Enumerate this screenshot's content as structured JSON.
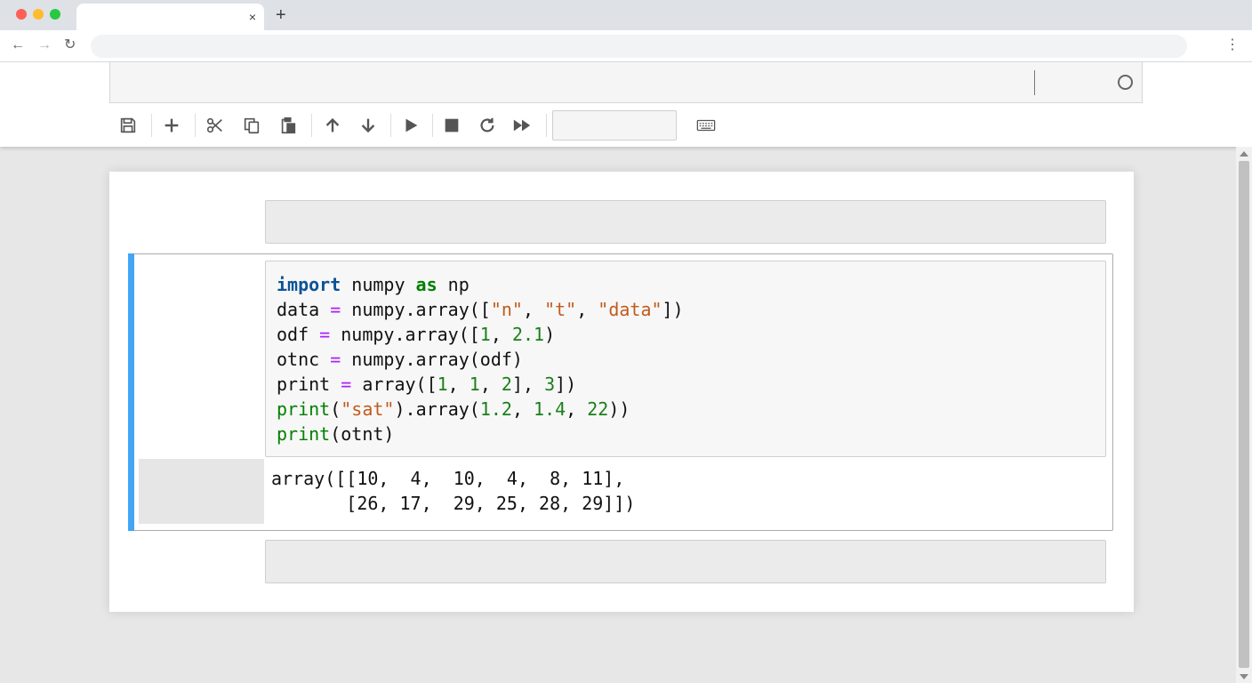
{
  "browser": {
    "tab_close": "×",
    "new_tab": "+",
    "back": "←",
    "forward": "→",
    "reload": "↻",
    "menu": "⋮",
    "traffic_colors": {
      "close": "#fe5f57",
      "minimize": "#febc2e",
      "maximize": "#28c840"
    }
  },
  "toolbar": {
    "icons": [
      "save-icon",
      "plus-icon",
      "scissors-icon",
      "copy-icon",
      "paste-icon",
      "arrow-up-icon",
      "arrow-down-icon",
      "run-icon",
      "stop-icon",
      "restart-icon",
      "fast-forward-icon",
      "keyboard-icon"
    ]
  },
  "cell": {
    "accent_color": "#42a5f5",
    "code_lines": [
      [
        {
          "t": "import",
          "c": "kw-imp"
        },
        {
          "t": " numpy ",
          "c": ""
        },
        {
          "t": "as",
          "c": "kw"
        },
        {
          "t": " np",
          "c": ""
        }
      ],
      [
        {
          "t": "data ",
          "c": ""
        },
        {
          "t": "=",
          "c": "op"
        },
        {
          "t": " numpy.array([",
          "c": ""
        },
        {
          "t": "\"n\"",
          "c": "str"
        },
        {
          "t": ", ",
          "c": ""
        },
        {
          "t": "\"t\"",
          "c": "str"
        },
        {
          "t": ", ",
          "c": ""
        },
        {
          "t": "\"data\"",
          "c": "str"
        },
        {
          "t": "])",
          "c": ""
        }
      ],
      [
        {
          "t": "odf ",
          "c": ""
        },
        {
          "t": "=",
          "c": "op"
        },
        {
          "t": " numpy.array([",
          "c": ""
        },
        {
          "t": "1",
          "c": "num"
        },
        {
          "t": ", ",
          "c": ""
        },
        {
          "t": "2.1",
          "c": "num"
        },
        {
          "t": ")",
          "c": ""
        }
      ],
      [
        {
          "t": "otnc ",
          "c": ""
        },
        {
          "t": "=",
          "c": "op"
        },
        {
          "t": " numpy.array(odf)",
          "c": ""
        }
      ],
      [
        {
          "t": "print ",
          "c": ""
        },
        {
          "t": "=",
          "c": "op"
        },
        {
          "t": " array([",
          "c": ""
        },
        {
          "t": "1",
          "c": "num"
        },
        {
          "t": ", ",
          "c": ""
        },
        {
          "t": "1",
          "c": "num"
        },
        {
          "t": ", ",
          "c": ""
        },
        {
          "t": "2",
          "c": "num"
        },
        {
          "t": "], ",
          "c": ""
        },
        {
          "t": "3",
          "c": "num"
        },
        {
          "t": "])",
          "c": ""
        }
      ],
      [
        {
          "t": "print",
          "c": "bi"
        },
        {
          "t": "(",
          "c": ""
        },
        {
          "t": "\"sat\"",
          "c": "str"
        },
        {
          "t": ").array(",
          "c": ""
        },
        {
          "t": "1.2",
          "c": "num"
        },
        {
          "t": ", ",
          "c": ""
        },
        {
          "t": "1.4",
          "c": "num"
        },
        {
          "t": ", ",
          "c": ""
        },
        {
          "t": "22",
          "c": "num"
        },
        {
          "t": "))",
          "c": ""
        }
      ],
      [
        {
          "t": "print",
          "c": "bi"
        },
        {
          "t": "(otnt)",
          "c": ""
        }
      ]
    ],
    "output": "array([[10,  4,  10,  4,  8, 11],\n       [26, 17,  29, 25, 28, 29]])"
  }
}
